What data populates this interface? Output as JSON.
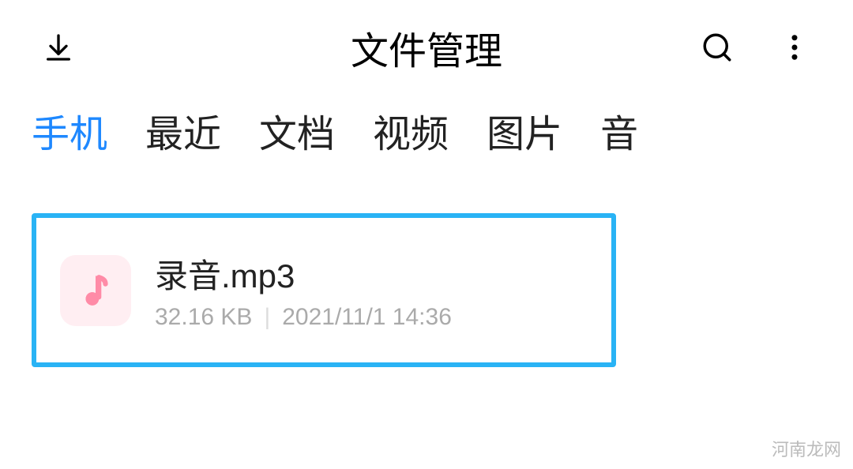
{
  "header": {
    "title": "文件管理"
  },
  "tabs": {
    "items": [
      "手机",
      "最近",
      "文档",
      "视频",
      "图片",
      "音"
    ],
    "active_index": 0
  },
  "file": {
    "name": "录音.mp3",
    "size": "32.16 KB",
    "date": "2021/11/1 14:36"
  },
  "watermark": "河南龙网"
}
